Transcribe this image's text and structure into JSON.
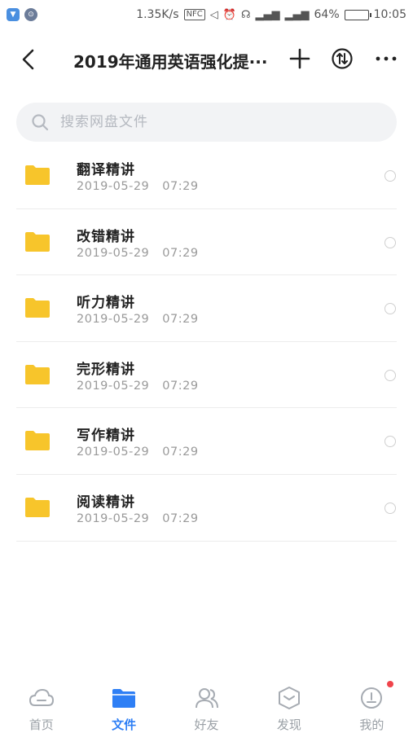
{
  "status_bar": {
    "app_badges": [
      "shield-app",
      "circle-app"
    ],
    "network_speed": "1.35K/s",
    "nfc": "NFC",
    "signal_1": "4G",
    "battery_percent": "64%",
    "battery_level": 0.64,
    "time": "10:05"
  },
  "header": {
    "title": "2019年通用英语强化提···"
  },
  "search": {
    "placeholder": "搜索网盘文件"
  },
  "files": [
    {
      "name": "翻译精讲",
      "date": "2019-05-29",
      "time": "07:29"
    },
    {
      "name": "改错精讲",
      "date": "2019-05-29",
      "time": "07:29"
    },
    {
      "name": "听力精讲",
      "date": "2019-05-29",
      "time": "07:29"
    },
    {
      "name": "完形精讲",
      "date": "2019-05-29",
      "time": "07:29"
    },
    {
      "name": "写作精讲",
      "date": "2019-05-29",
      "time": "07:29"
    },
    {
      "name": "阅读精讲",
      "date": "2019-05-29",
      "time": "07:29"
    }
  ],
  "nav": [
    {
      "label": "首页",
      "icon": "cloud-icon",
      "active": false
    },
    {
      "label": "文件",
      "icon": "folder-icon",
      "active": true
    },
    {
      "label": "好友",
      "icon": "friends-icon",
      "active": false
    },
    {
      "label": "发现",
      "icon": "discover-icon",
      "active": false
    },
    {
      "label": "我的",
      "icon": "profile-icon",
      "active": false,
      "badge": true
    }
  ],
  "colors": {
    "accent": "#2e7ff5",
    "folder": "#f7c52b",
    "badge": "#f0444b"
  }
}
